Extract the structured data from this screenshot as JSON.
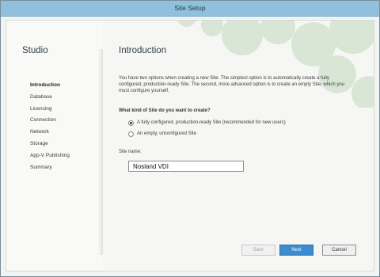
{
  "window": {
    "title": "Site Setup"
  },
  "sidebar": {
    "brand": "Studio",
    "items": [
      {
        "label": "Introduction",
        "active": true
      },
      {
        "label": "Database",
        "active": false
      },
      {
        "label": "Licensing",
        "active": false
      },
      {
        "label": "Connection",
        "active": false
      },
      {
        "label": "Network",
        "active": false
      },
      {
        "label": "Storage",
        "active": false
      },
      {
        "label": "App-V Publishing",
        "active": false
      },
      {
        "label": "Summary",
        "active": false
      }
    ]
  },
  "main": {
    "heading": "Introduction",
    "description": "You have two options when creating a new Site. The simplest option is to automatically create a fully configured, production-ready Site. The second, more advanced option is to create an empty Site, which you must configure yourself.",
    "question": "What kind of Site do you want to create?",
    "options": [
      {
        "label": "A fully configured, production-ready Site (recommended for new users)",
        "selected": true
      },
      {
        "label": "An empty, unconfigured Site",
        "selected": false
      }
    ],
    "site_name_label": "Site name:",
    "site_name_value": "Nosland VDI"
  },
  "buttons": {
    "back": "Back",
    "next": "Next",
    "cancel": "Cancel"
  },
  "colors": {
    "titlebar": "#8fc0dc",
    "primary_button": "#3c8cd0",
    "decoration": "#d3e2cf"
  }
}
